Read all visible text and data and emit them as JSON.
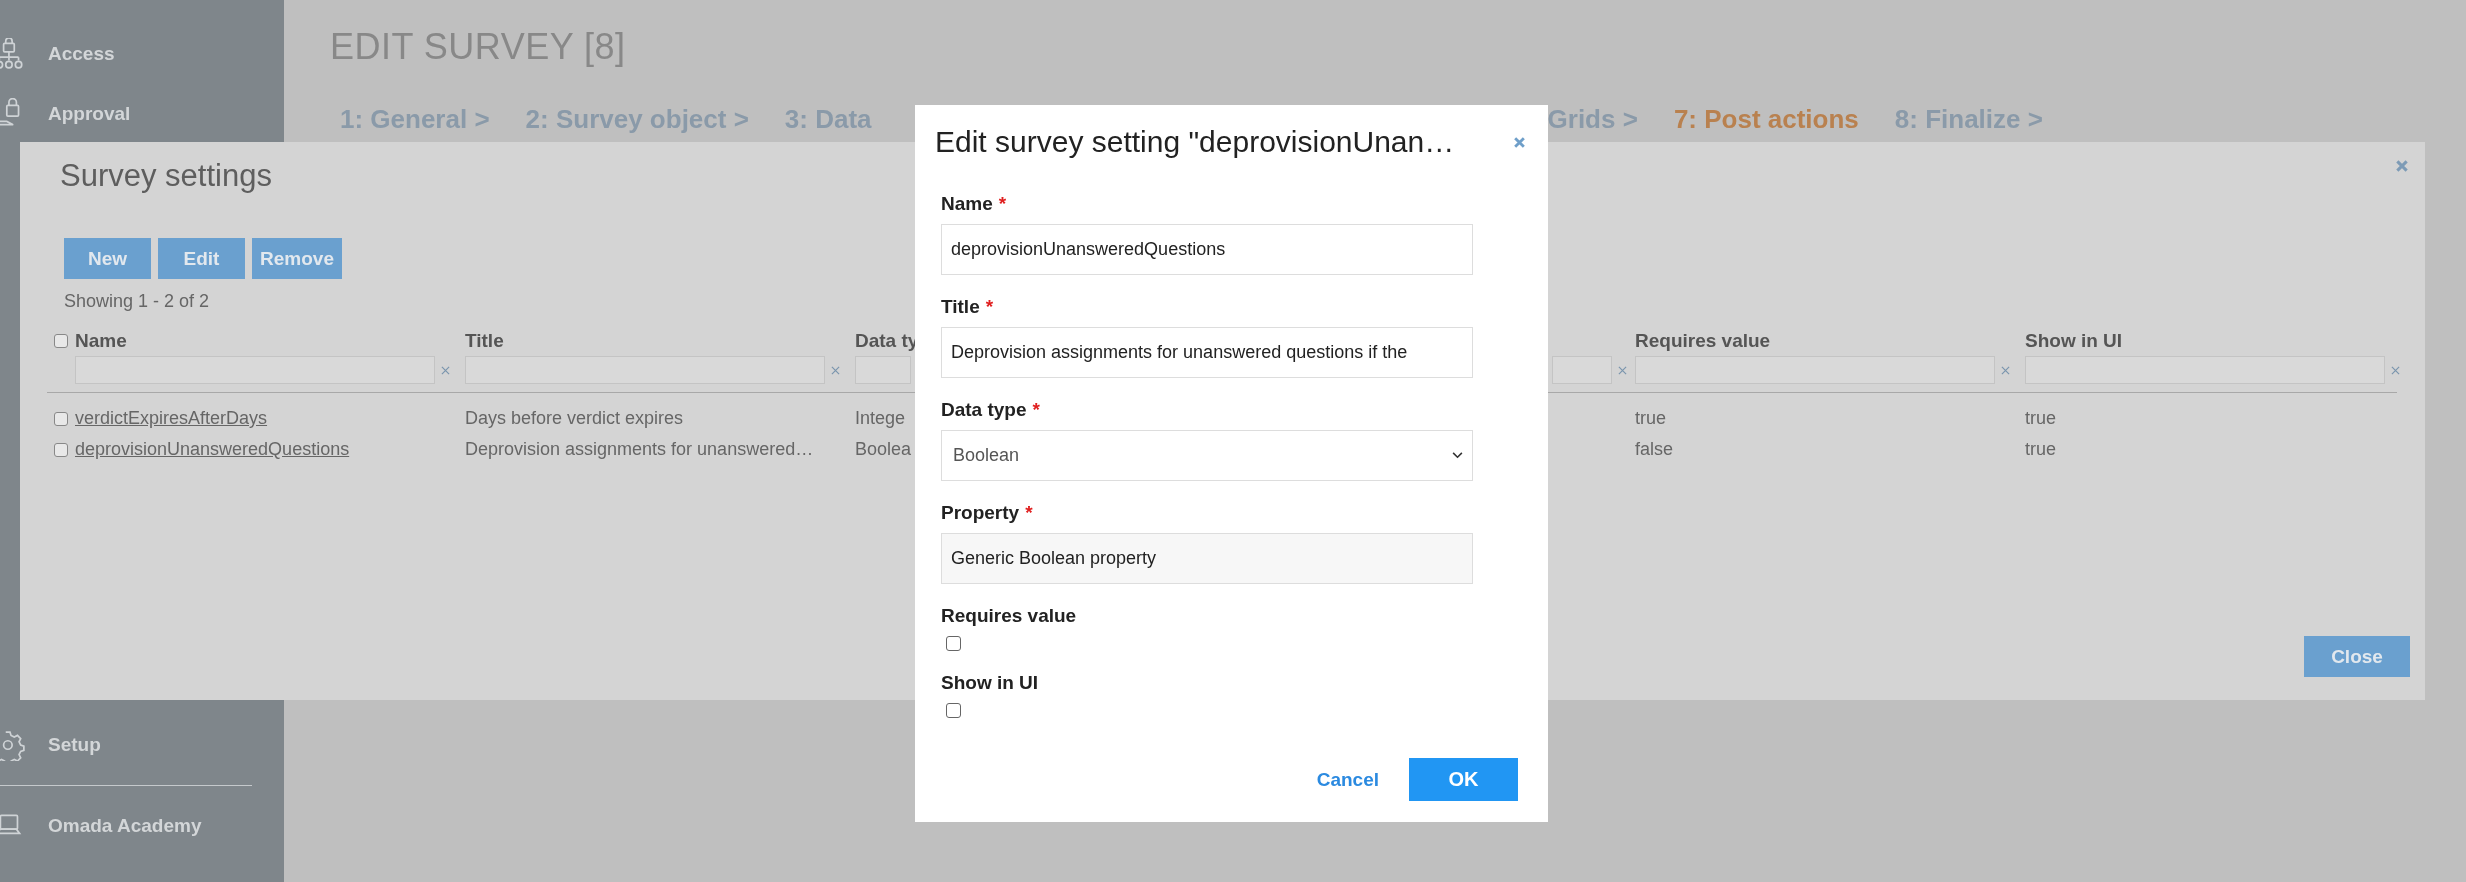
{
  "sidebar": {
    "items": [
      {
        "label": "Access"
      },
      {
        "label": "Approval"
      },
      {
        "label": "Setup"
      },
      {
        "label": "Omada Academy"
      }
    ]
  },
  "page": {
    "title": "EDIT SURVEY [8]",
    "steps": [
      {
        "label": "1: General >",
        "selected": false
      },
      {
        "label": "2: Survey object >",
        "selected": false
      },
      {
        "label": "3: Data",
        "selected": false
      },
      {
        "label": "Grids >",
        "selected": false
      },
      {
        "label": "7: Post actions",
        "selected": true
      },
      {
        "label": "8: Finalize >",
        "selected": false
      }
    ]
  },
  "survey_settings": {
    "title": "Survey settings",
    "buttons": [
      "New",
      "Edit",
      "Remove"
    ],
    "count": "Showing 1 - 2 of 2",
    "columns": [
      "Name",
      "Title",
      "Data ty",
      "Requires value",
      "Show in UI"
    ],
    "all_selected": false,
    "rows": [
      {
        "selected": false,
        "cells": [
          "verdictExpiresAfterDays",
          "Days before verdict expires",
          "Intege",
          "true",
          "true"
        ]
      },
      {
        "selected": false,
        "cells": [
          "deprovisionUnansweredQuestions",
          "Deprovision assignments for unanswered…",
          "Boolea",
          "false",
          "true"
        ]
      }
    ],
    "close_button": "Close"
  },
  "dialog": {
    "title": "Edit survey setting \"deprovisionUnan…",
    "fields": [
      {
        "kind": "text",
        "label": "Name",
        "required": true,
        "value": "deprovisionUnansweredQuestions"
      },
      {
        "kind": "text",
        "label": "Title",
        "required": true,
        "value": "Deprovision assignments for unanswered questions if the"
      },
      {
        "kind": "select",
        "label": "Data type",
        "required": true,
        "value": "Boolean"
      },
      {
        "kind": "readonly",
        "label": "Property",
        "required": true,
        "value": "Generic Boolean property"
      },
      {
        "kind": "checkbox",
        "label": "Requires value",
        "required": false,
        "checked": false
      },
      {
        "kind": "checkbox",
        "label": "Show in UI",
        "required": false,
        "checked": false
      }
    ],
    "required_mark": "*",
    "cancel": "Cancel",
    "ok": "OK"
  }
}
